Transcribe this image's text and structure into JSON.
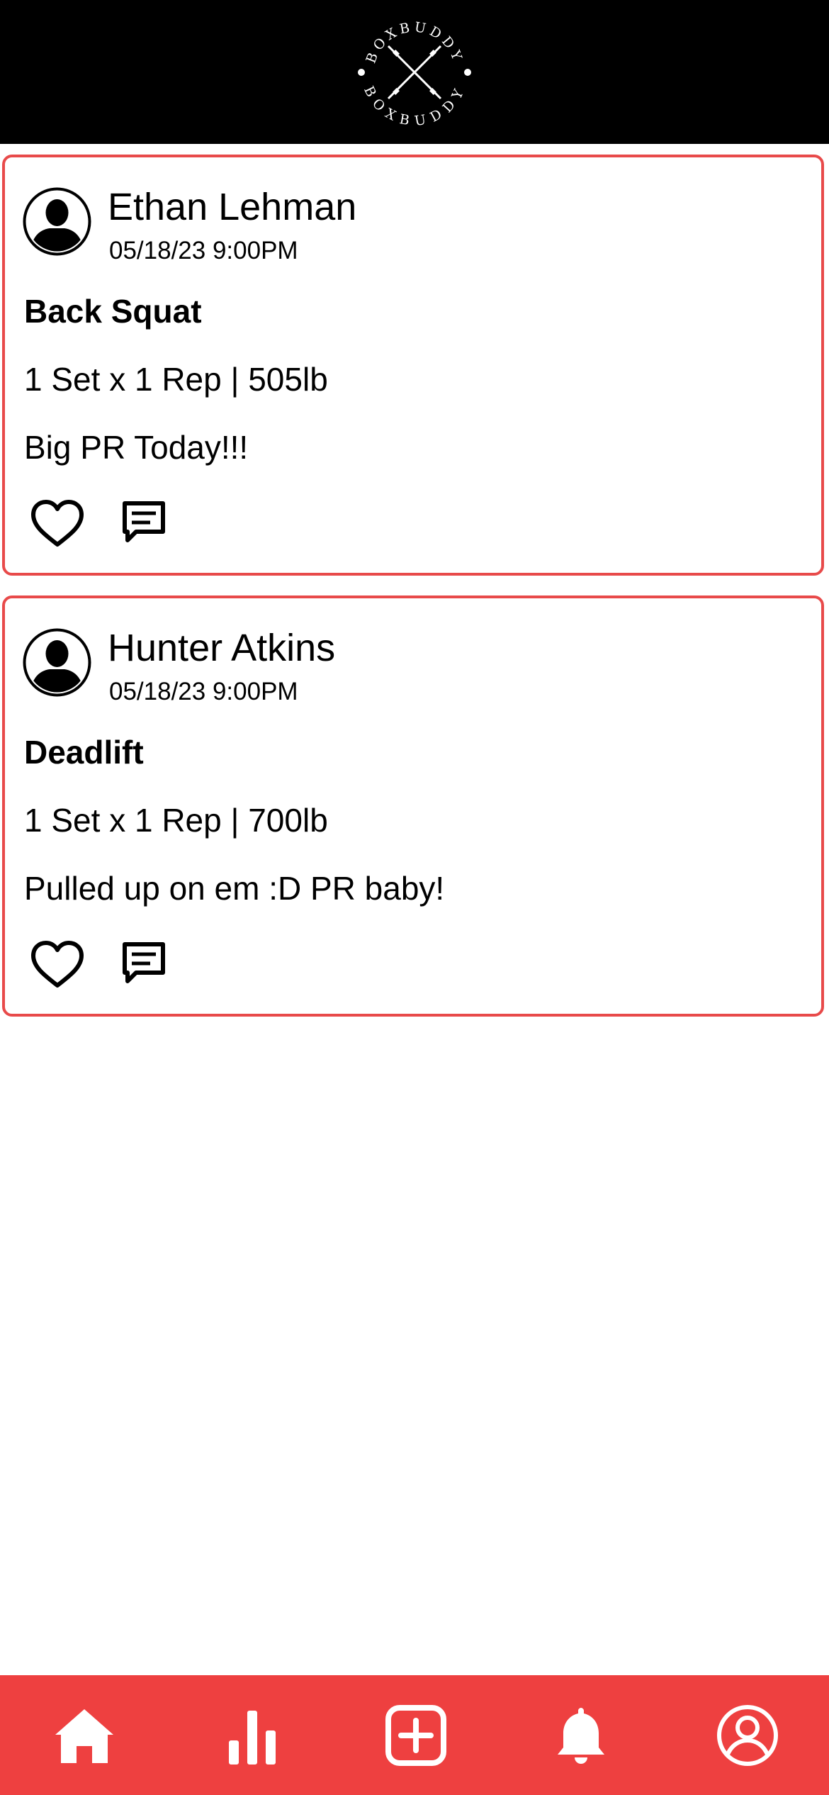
{
  "app": {
    "brand_text": "BOXBUDDY"
  },
  "colors": {
    "header_bg": "#000000",
    "accent": "#ee4040",
    "card_border": "#e84a4a",
    "text": "#000000"
  },
  "feed": {
    "posts": [
      {
        "author": "Ethan Lehman",
        "timestamp": "05/18/23 9:00PM",
        "exercise": "Back Squat",
        "detail": "1 Set x 1 Rep | 505lb",
        "caption": "Big PR Today!!!",
        "avatar_icon": "user-silhouette-icon",
        "like_icon": "heart-outline-icon",
        "comment_icon": "comment-icon"
      },
      {
        "author": "Hunter Atkins",
        "timestamp": "05/18/23 9:00PM",
        "exercise": "Deadlift",
        "detail": "1 Set x 1 Rep | 700lb",
        "caption": "Pulled up on em :D PR baby!",
        "avatar_icon": "user-silhouette-icon",
        "like_icon": "heart-outline-icon",
        "comment_icon": "comment-icon"
      }
    ]
  },
  "tab_bar": {
    "tabs": [
      {
        "icon": "home-icon",
        "selected": true
      },
      {
        "icon": "bar-chart-icon",
        "selected": false
      },
      {
        "icon": "add-square-icon",
        "selected": false
      },
      {
        "icon": "bell-icon",
        "selected": false
      },
      {
        "icon": "profile-circle-icon",
        "selected": false
      }
    ]
  }
}
